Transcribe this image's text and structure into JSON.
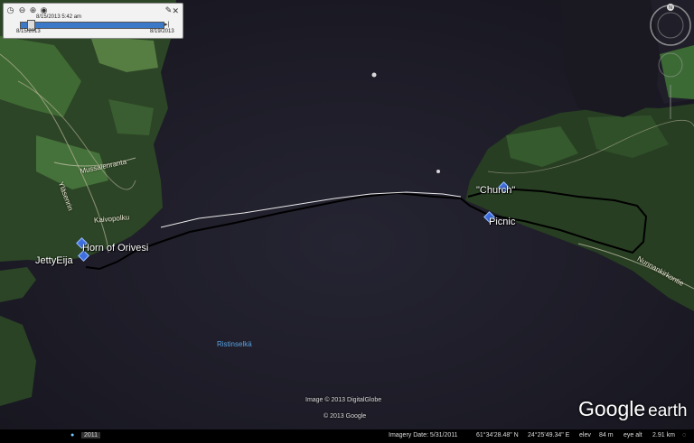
{
  "time_slider": {
    "current": "8/15/2013  5:42 am",
    "start_date": "8/15/2013",
    "end_date": "8/19/2013"
  },
  "places": {
    "church": "\"Church\"",
    "picnic": "Picnic",
    "horn": "Horn of Orivesi",
    "jetty": "JettyEija"
  },
  "roads": [
    "Mussalenranta",
    "Kaivopolku",
    "Yläsenrin",
    "Nunnankirkontie"
  ],
  "water_label": "Ristinselkä",
  "credits": {
    "image": "Image © 2013 DigitalGlobe",
    "google": "© 2013 Google"
  },
  "logo": {
    "brand": "Google",
    "product": "earth"
  },
  "status": {
    "year": "2011",
    "imagery_date": "Imagery Date: 5/31/2011",
    "lat": "61°34'28.48\" N",
    "lon": "24°25'49.34\" E",
    "elev_label": "elev",
    "elev": "84 m",
    "eye_label": "eye alt",
    "eye_alt": "2.91 km"
  },
  "colors": {
    "water": "#1d1c27",
    "forest": "#2f4a28",
    "field": "#4c7a3c",
    "track": "#000000",
    "track_highlight": "#ffffff"
  },
  "icons": [
    "zoom-in-icon",
    "zoom-out-icon",
    "wrench-icon",
    "close-icon",
    "compass-icon",
    "look-joystick-icon",
    "move-joystick-icon",
    "placemark-pin-icon"
  ]
}
